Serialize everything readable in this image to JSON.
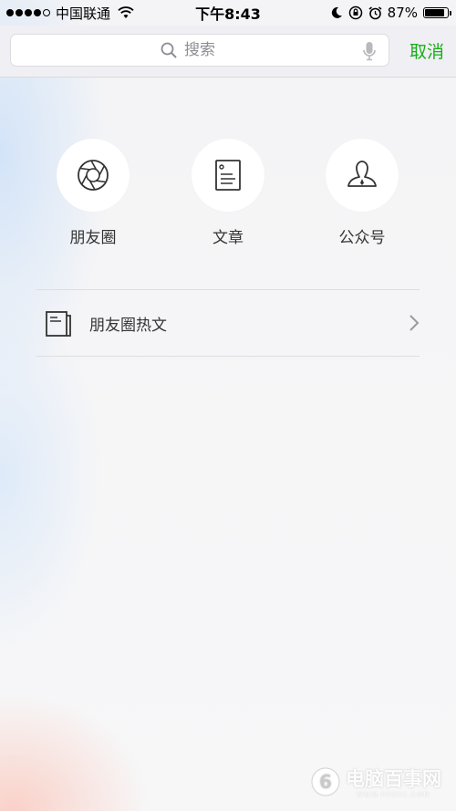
{
  "status_bar": {
    "carrier": "中国联通",
    "time": "下午8:43",
    "battery": "87%",
    "battery_level": 0.87,
    "signal_bars": 4
  },
  "search": {
    "placeholder": "搜索",
    "cancel_label": "取消",
    "accent_color": "#1aad19"
  },
  "quick_links": [
    {
      "label": "朋友圈",
      "icon": "moments-aperture-icon"
    },
    {
      "label": "文章",
      "icon": "article-document-icon"
    },
    {
      "label": "公众号",
      "icon": "official-account-person-icon"
    }
  ],
  "hot_articles": {
    "label": "朋友圈热文",
    "icon": "newspaper-icon"
  },
  "watermark": {
    "text": "电脑百事网",
    "subtext": "WWW.PC841.COM"
  }
}
